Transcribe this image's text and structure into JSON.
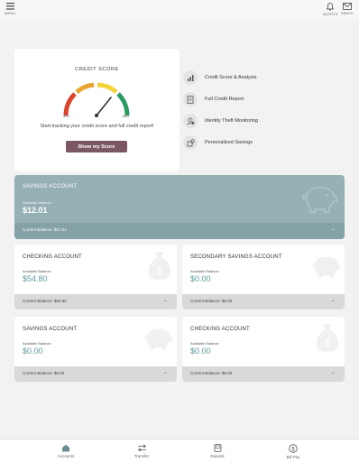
{
  "topbar": {
    "menu_label": "MENU",
    "alerts_label": "ALERTS",
    "inbox_label": "INBOX"
  },
  "credit": {
    "title": "CREDIT SCORE",
    "min_label": "300",
    "max_label": "850",
    "gauge_colors": [
      "#d9442b",
      "#e8a431",
      "#f2d43a",
      "#2e9b63"
    ],
    "description": "Start tracking your credit score and full credit report!",
    "button_label": "Show my Score",
    "button_color": "#7a5763"
  },
  "features": [
    {
      "label": "Credit Score & Analysis",
      "icon": "chart-icon"
    },
    {
      "label": "Full Credit Report",
      "icon": "report-icon"
    },
    {
      "label": "Identity Theft Monitoring",
      "icon": "identity-icon"
    },
    {
      "label": "Personalized Savings",
      "icon": "savings-icon"
    }
  ],
  "accounts": [
    {
      "name": "SAVINGS ACCOUNT",
      "available_label": "Available Balance",
      "available": "$12.01",
      "current": "Current Balance: $17.01",
      "watermark": "piggy-bank-icon"
    },
    {
      "name": "CHECKING ACCOUNT",
      "available_label": "Available Balance",
      "available": "$54.80",
      "current": "Current Balance: $54.80",
      "watermark": "money-bag-icon"
    },
    {
      "name": "SECONDARY SAVINGS ACCOUNT",
      "available_label": "Available Balance",
      "available": "$0.00",
      "current": "Current Balance: $0.00",
      "watermark": "piggy-bank-icon"
    },
    {
      "name": "SAVINGS ACCOUNT",
      "available_label": "Available Balance",
      "available": "$0.00",
      "current": "Current Balance: $0.00",
      "watermark": "piggy-bank-icon"
    },
    {
      "name": "CHECKING ACCOUNT",
      "available_label": "Available Balance",
      "available": "$0.00",
      "current": "Current Balance: $0.00",
      "watermark": "money-bag-icon"
    }
  ],
  "nav": [
    {
      "label": "Accounts",
      "icon": "home-icon"
    },
    {
      "label": "Transfer",
      "icon": "transfer-icon"
    },
    {
      "label": "Deposit",
      "icon": "deposit-icon"
    },
    {
      "label": "Bill Pay",
      "icon": "bill-pay-icon"
    }
  ],
  "colors": {
    "accent": "#7a5763",
    "primary_card": "#96b1b6",
    "balance_text": "#5e9a9a"
  }
}
